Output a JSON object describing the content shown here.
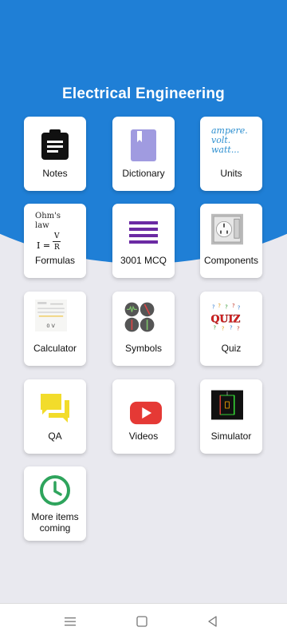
{
  "app": {
    "title": "Electrical Engineering"
  },
  "tiles": [
    {
      "label": "Notes"
    },
    {
      "label": "Dictionary"
    },
    {
      "label": "Units",
      "image_text": "ampere.\nvolt.\nwatt..."
    },
    {
      "label": "Formulas",
      "image_text": "Ohm's law"
    },
    {
      "label": "3001 MCQ"
    },
    {
      "label": "Components"
    },
    {
      "label": "Calculator"
    },
    {
      "label": "Symbols"
    },
    {
      "label": "Quiz",
      "image_text": "QUIZ"
    },
    {
      "label": "QA"
    },
    {
      "label": "Videos"
    },
    {
      "label": "Simulator"
    },
    {
      "label": "More items coming"
    }
  ],
  "colors": {
    "primary_blue": "#1f7fd6",
    "background": "#e9e9ef",
    "notes_icon": "#111111",
    "dictionary_icon": "#a09be0",
    "mcq_icon": "#6b2aa3",
    "qa_icon": "#f2dc2b",
    "videos_icon": "#e53935",
    "clock_icon": "#2ea45c"
  },
  "nav": {
    "menu": "menu-icon",
    "home": "home-icon",
    "back": "back-icon"
  }
}
